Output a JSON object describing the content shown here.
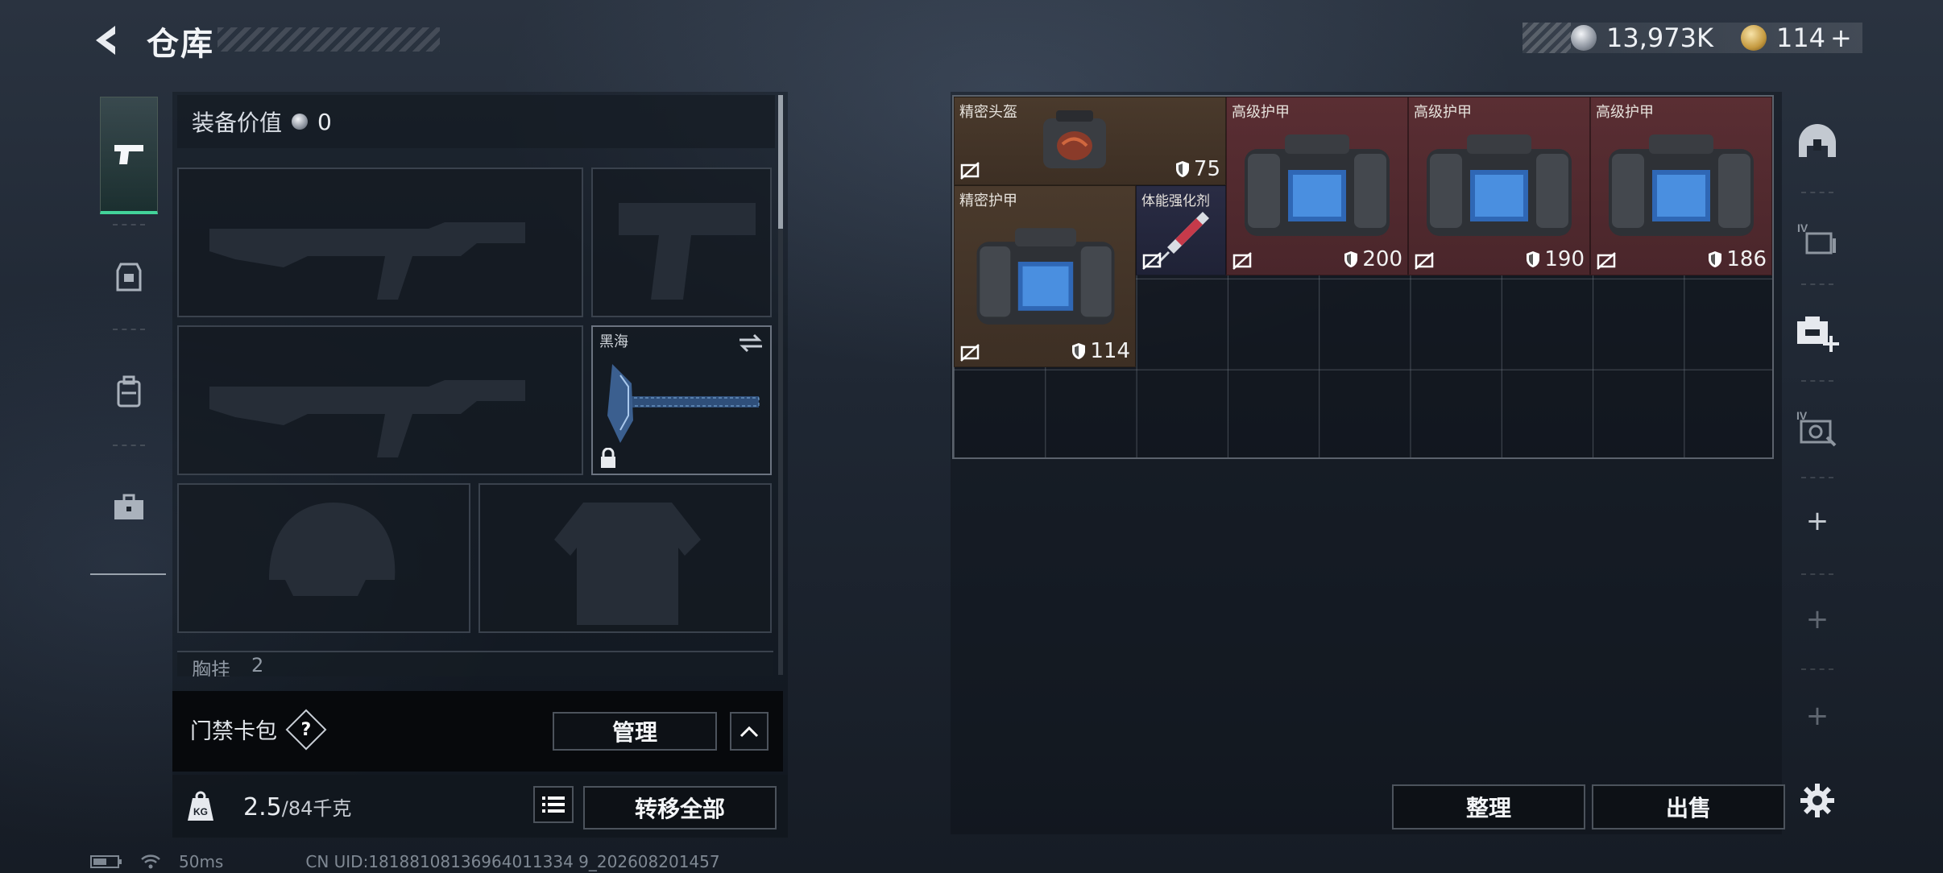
{
  "header": {
    "title": "仓库",
    "currency_silver": "13,973K",
    "currency_gold": "114",
    "currency_gold_plus": "+"
  },
  "left_tabs": [
    {
      "name": "weapons",
      "icon": "pistol-icon",
      "active": true
    },
    {
      "name": "gear",
      "icon": "armor-icon",
      "active": false
    },
    {
      "name": "backpack",
      "icon": "backpack-icon",
      "active": false
    },
    {
      "name": "case",
      "icon": "toolbox-icon",
      "active": false
    }
  ],
  "loadout": {
    "equip_value_label": "装备价值",
    "equip_value": "0",
    "melee_name": "黑海",
    "chest_rig_label": "胸挂",
    "chest_rig_count": "2",
    "keycard_label": "门禁卡包",
    "help_glyph": "?",
    "manage_button": "管理",
    "weight_current": "2.5",
    "weight_separator": "/",
    "weight_max": "84",
    "weight_unit": "千克",
    "transfer_all_button": "转移全部"
  },
  "stash": {
    "items": [
      {
        "name": "精密头盔",
        "durability": "75",
        "color": "brown"
      },
      {
        "name": "高级护甲",
        "durability": "200",
        "color": "red"
      },
      {
        "name": "高级护甲",
        "durability": "190",
        "color": "red"
      },
      {
        "name": "高级护甲",
        "durability": "186",
        "color": "red"
      },
      {
        "name": "精密护甲",
        "durability": "114",
        "color": "brown"
      },
      {
        "name": "体能强化剂",
        "durability": "",
        "color": "navy"
      }
    ],
    "sort_button": "整理",
    "sell_button": "出售"
  },
  "side_tabs": [
    {
      "icon": "helmet-icon"
    },
    {
      "icon": "stash-iv-icon"
    },
    {
      "icon": "add-stash-icon"
    },
    {
      "icon": "stash-iv-settings-icon"
    }
  ],
  "status": {
    "ping": "50ms",
    "uid": "CN UID:18188108136964011334 9_202608201457"
  },
  "colors": {
    "accent_green": "#43d39a",
    "item_brown": "#4a3a2c",
    "item_red": "#5a2e33",
    "item_navy": "#2a2c44"
  }
}
